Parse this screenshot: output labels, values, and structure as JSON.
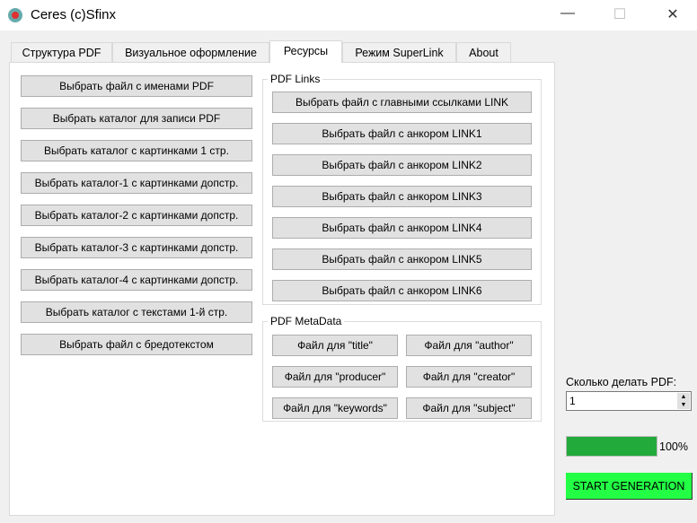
{
  "window": {
    "title": "Ceres (c)Sfinx",
    "minimize": "—",
    "maximize": "☐",
    "close": "✕"
  },
  "tabs": [
    "Структура PDF",
    "Визуальное оформление",
    "Ресурсы",
    "Режим SuperLink",
    "About"
  ],
  "left_buttons": [
    "Выбрать файл с именами PDF",
    "Выбрать каталог для записи PDF",
    "Выбрать каталог с картинками 1 стр.",
    "Выбрать каталог-1 с картинками допстр.",
    "Выбрать каталог-2 с картинками допстр.",
    "Выбрать каталог-3 с картинками допстр.",
    "Выбрать каталог-4 с картинками допстр.",
    "Выбрать каталог с текстами 1-й стр.",
    "Выбрать файл с бредотекстом"
  ],
  "links": {
    "title": "PDF Links",
    "buttons": [
      "Выбрать файл с главными ссылками LINK",
      "Выбрать файл с анкором LINK1",
      "Выбрать файл с анкором LINK2",
      "Выбрать файл с анкором LINK3",
      "Выбрать файл с анкором LINK4",
      "Выбрать файл с анкором LINK5",
      "Выбрать файл с анкором LINK6"
    ]
  },
  "meta": {
    "title": "PDF MetaData",
    "buttons": [
      "Файл для \"title\"",
      "Файл для \"author\"",
      "Файл для \"producer\"",
      "Файл для \"creator\"",
      "Файл для \"keywords\"",
      "Файл для \"subject\""
    ]
  },
  "count": {
    "label": "Сколько делать PDF:",
    "value": "1"
  },
  "progress": {
    "percent": 100,
    "label": "100%",
    "color": "#22aa3a"
  },
  "start": {
    "label": "START GENERATION",
    "color": "#22ff44"
  }
}
